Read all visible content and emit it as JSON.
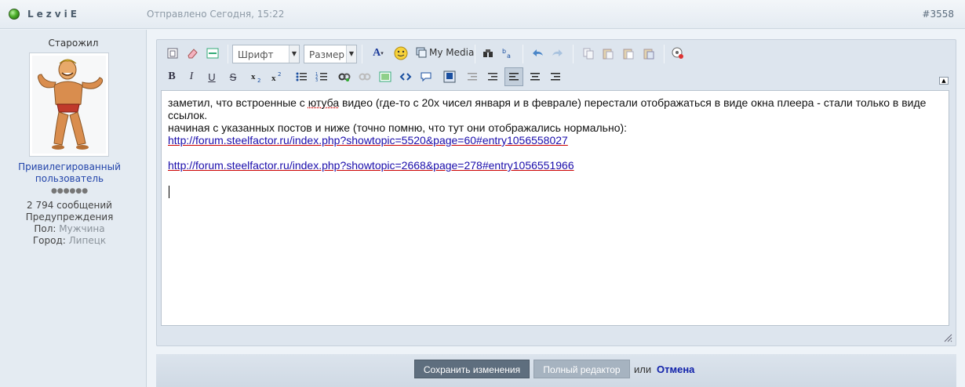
{
  "header": {
    "author": "LezviE",
    "posted": "Отправлено Сегодня, 15:22",
    "post_number": "#3558"
  },
  "sidebar": {
    "rank_title": "Старожил",
    "group_line1": "Привилегированный",
    "group_line2": "пользователь",
    "pips": "●●●●●●",
    "messages": "2 794 сообщений",
    "warnings": "Предупреждения",
    "gender_label": "Пол:",
    "gender_value": "Мужчина",
    "city_label": "Город:",
    "city_value": "Липецк"
  },
  "toolbar": {
    "font_select": "Шрифт",
    "size_select": "Размер",
    "my_media": "My Media",
    "icons_row1": [
      "source-icon",
      "eraser-icon",
      "insert-hr-icon",
      "font-color-icon",
      "smiley-icon",
      "my-media-icon",
      "spellcheck-icon",
      "special-chars-icon",
      "undo-icon",
      "redo-icon",
      "copy-icon",
      "paste-icon",
      "paste-text-icon",
      "paste-word-icon",
      "settings-icon"
    ],
    "icons_row2": [
      "bold-icon",
      "italic-icon",
      "underline-icon",
      "strikethrough-icon",
      "subscript-icon",
      "superscript-icon",
      "bullet-list-icon",
      "numbered-list-icon",
      "link-icon",
      "unlink-icon",
      "image-icon",
      "code-icon",
      "quote-icon",
      "media-icon",
      "indent-decrease-icon",
      "indent-increase-icon",
      "align-left-icon",
      "align-center-icon",
      "align-right-icon"
    ],
    "bold_glyph": "B",
    "italic_glyph": "I",
    "underline_glyph": "U",
    "strike_glyph": "S"
  },
  "content": {
    "line1_a": "заметил, что встроенные с ",
    "line1_yt": "ютуба",
    "line1_b": " видео (где-то с 20х чисел января и в феврале) перестали отображаться в виде окна плеера - стали только в виде ссылок.",
    "line2": "начиная с указанных постов и ниже (точно помню, что тут они отображались нормально):",
    "link1": "http://forum.steelfactor.ru/index.php?showtopic=5520&page=60#entry1056558027",
    "link2": "http://forum.steelfactor.ru/index.php?showtopic=2668&page=278#entry1056551966"
  },
  "footer": {
    "save_label": "Сохранить изменения",
    "full_editor_label": "Полный редактор",
    "or_text": "или",
    "cancel_label": "Отмена"
  }
}
